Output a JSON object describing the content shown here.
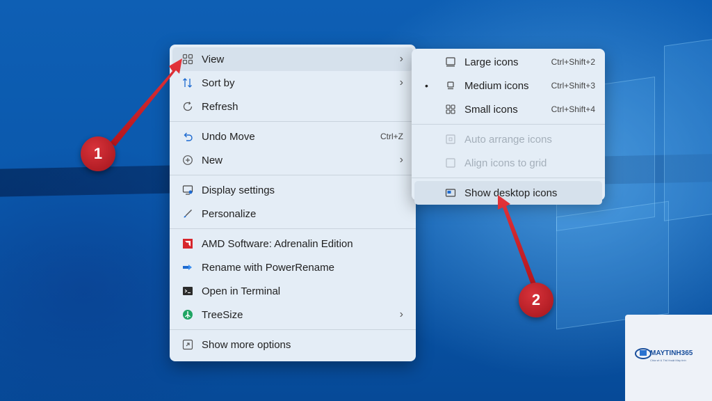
{
  "context_menu": {
    "items": [
      {
        "label": "View",
        "icon": "grid-icon",
        "chevron": "›"
      },
      {
        "label": "Sort by",
        "icon": "sort-icon",
        "chevron": "›"
      },
      {
        "label": "Refresh",
        "icon": "refresh-icon"
      },
      {
        "label": "Undo Move",
        "icon": "undo-icon",
        "shortcut": "Ctrl+Z"
      },
      {
        "label": "New",
        "icon": "plus-icon",
        "chevron": "›"
      },
      {
        "label": "Display settings",
        "icon": "display-icon"
      },
      {
        "label": "Personalize",
        "icon": "brush-icon"
      },
      {
        "label": "AMD Software: Adrenalin Edition",
        "icon": "amd-icon"
      },
      {
        "label": "Rename with PowerRename",
        "icon": "powerrename-icon"
      },
      {
        "label": "Open in Terminal",
        "icon": "terminal-icon"
      },
      {
        "label": "TreeSize",
        "icon": "treesize-icon",
        "chevron": "›"
      },
      {
        "label": "Show more options",
        "icon": "more-options-icon"
      }
    ]
  },
  "view_submenu": {
    "items": [
      {
        "label": "Large icons",
        "shortcut": "Ctrl+Shift+2",
        "icon": "large-icons-icon"
      },
      {
        "label": "Medium icons",
        "shortcut": "Ctrl+Shift+3",
        "icon": "medium-icons-icon",
        "selected_marker": "•"
      },
      {
        "label": "Small icons",
        "shortcut": "Ctrl+Shift+4",
        "icon": "small-icons-icon"
      },
      {
        "label": "Auto arrange icons",
        "icon": "auto-arrange-icon",
        "disabled": true
      },
      {
        "label": "Align icons to grid",
        "icon": "align-grid-icon",
        "disabled": true
      },
      {
        "label": "Show desktop icons",
        "icon": "show-desktop-icon"
      }
    ]
  },
  "annotations": {
    "step1": "1",
    "step2": "2"
  },
  "watermark": {
    "brand": "MAYTINH365",
    "tagline": "Chia sẻ & Thủ thuật Máy tính"
  },
  "colors": {
    "accent": "#0a5cc2",
    "badge": "#c0202a",
    "menu_bg": "#e4edf6"
  }
}
